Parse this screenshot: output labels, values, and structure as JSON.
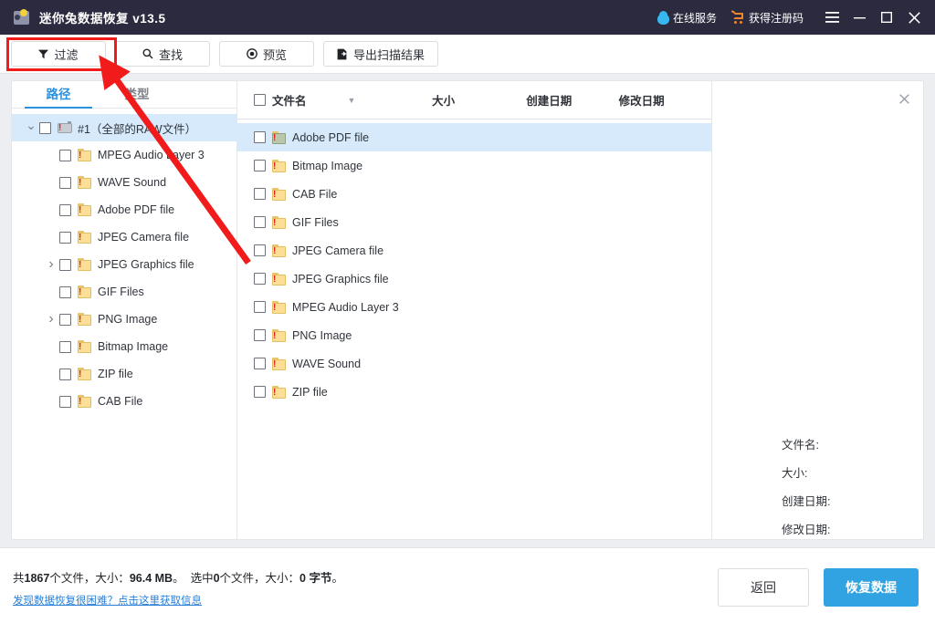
{
  "window": {
    "title": "迷你兔数据恢复 v13.5",
    "logo_icon": "app-logo-icon",
    "online_service": "在线服务",
    "online_service_icon": "penguin-icon",
    "get_license": "获得注册码",
    "get_license_icon": "cart-icon",
    "menu_icon": "hamburger-menu-icon",
    "minimize_icon": "minimize-icon",
    "maximize_icon": "maximize-icon",
    "close_icon": "close-icon"
  },
  "toolbar": {
    "buttons": [
      {
        "label": "过滤",
        "icon": "filter-icon"
      },
      {
        "label": "查找",
        "icon": "search-icon"
      },
      {
        "label": "预览",
        "icon": "eye-icon"
      },
      {
        "label": "导出扫描结果",
        "icon": "export-document-icon"
      }
    ]
  },
  "left_panel": {
    "tabs": [
      {
        "label": "路径",
        "active": true
      },
      {
        "label": "类型",
        "active": false
      }
    ],
    "tree": [
      {
        "label": "#1（全部的RAW文件）",
        "indent": 0,
        "expander": "expanded",
        "selected": true,
        "icon": "device-icon"
      },
      {
        "label": "MPEG Audio Layer 3",
        "indent": 1,
        "expander": "none",
        "selected": false,
        "icon": "raw-folder-icon"
      },
      {
        "label": "WAVE Sound",
        "indent": 1,
        "expander": "none",
        "selected": false,
        "icon": "raw-folder-icon"
      },
      {
        "label": "Adobe PDF file",
        "indent": 1,
        "expander": "none",
        "selected": false,
        "icon": "raw-folder-icon"
      },
      {
        "label": "JPEG Camera file",
        "indent": 1,
        "expander": "none",
        "selected": false,
        "icon": "raw-folder-icon"
      },
      {
        "label": "JPEG Graphics file",
        "indent": 1,
        "expander": "collapsed",
        "selected": false,
        "icon": "raw-folder-icon"
      },
      {
        "label": "GIF Files",
        "indent": 1,
        "expander": "none",
        "selected": false,
        "icon": "raw-folder-icon"
      },
      {
        "label": "PNG Image",
        "indent": 1,
        "expander": "collapsed",
        "selected": false,
        "icon": "raw-folder-icon"
      },
      {
        "label": "Bitmap Image",
        "indent": 1,
        "expander": "none",
        "selected": false,
        "icon": "raw-folder-icon"
      },
      {
        "label": "ZIP file",
        "indent": 1,
        "expander": "none",
        "selected": false,
        "icon": "raw-folder-icon"
      },
      {
        "label": "CAB File",
        "indent": 1,
        "expander": "none",
        "selected": false,
        "icon": "raw-folder-icon"
      }
    ]
  },
  "file_list": {
    "columns": [
      {
        "label": "文件名",
        "sorted": true,
        "sort_icon": "sort-desc-caret-icon"
      },
      {
        "label": "大小",
        "sorted": false
      },
      {
        "label": "创建日期",
        "sorted": false
      },
      {
        "label": "修改日期",
        "sorted": false
      }
    ],
    "rows": [
      {
        "name": "Adobe PDF file",
        "size": "",
        "created": "",
        "modified": "",
        "selected": true
      },
      {
        "name": "Bitmap Image",
        "size": "",
        "created": "",
        "modified": "",
        "selected": false
      },
      {
        "name": "CAB File",
        "size": "",
        "created": "",
        "modified": "",
        "selected": false
      },
      {
        "name": "GIF Files",
        "size": "",
        "created": "",
        "modified": "",
        "selected": false
      },
      {
        "name": "JPEG Camera file",
        "size": "",
        "created": "",
        "modified": "",
        "selected": false
      },
      {
        "name": "JPEG Graphics file",
        "size": "",
        "created": "",
        "modified": "",
        "selected": false
      },
      {
        "name": "MPEG Audio Layer 3",
        "size": "",
        "created": "",
        "modified": "",
        "selected": false
      },
      {
        "name": "PNG Image",
        "size": "",
        "created": "",
        "modified": "",
        "selected": false
      },
      {
        "name": "WAVE Sound",
        "size": "",
        "created": "",
        "modified": "",
        "selected": false
      },
      {
        "name": "ZIP file",
        "size": "",
        "created": "",
        "modified": "",
        "selected": false
      }
    ]
  },
  "details_panel": {
    "close_icon": "close-icon",
    "fields": [
      {
        "label": "文件名:",
        "value": ""
      },
      {
        "label": "大小:",
        "value": ""
      },
      {
        "label": "创建日期:",
        "value": ""
      },
      {
        "label": "修改日期:",
        "value": ""
      }
    ]
  },
  "status_bar": {
    "total_prefix": "共",
    "total_files": "1867",
    "total_mid": "个文件，大小：",
    "total_size": "96.4 MB",
    "total_suffix": "。",
    "selected_prefix": "选中",
    "selected_files": "0",
    "selected_mid": "个文件，大小：",
    "selected_size": "0 字节",
    "selected_suffix": "。",
    "help_link": "发现数据恢复很困难？点击这里获取信息",
    "back_button": "返回",
    "recover_button": "恢复数据"
  },
  "annotations": {
    "highlight_color": "#f21b1b",
    "target": "过滤"
  },
  "colors": {
    "titlebar": "#2b2a3e",
    "accent": "#2a90e0",
    "primary_button": "#32a3e2",
    "selection": "#d6eafb",
    "annotation": "#f21b1b"
  }
}
